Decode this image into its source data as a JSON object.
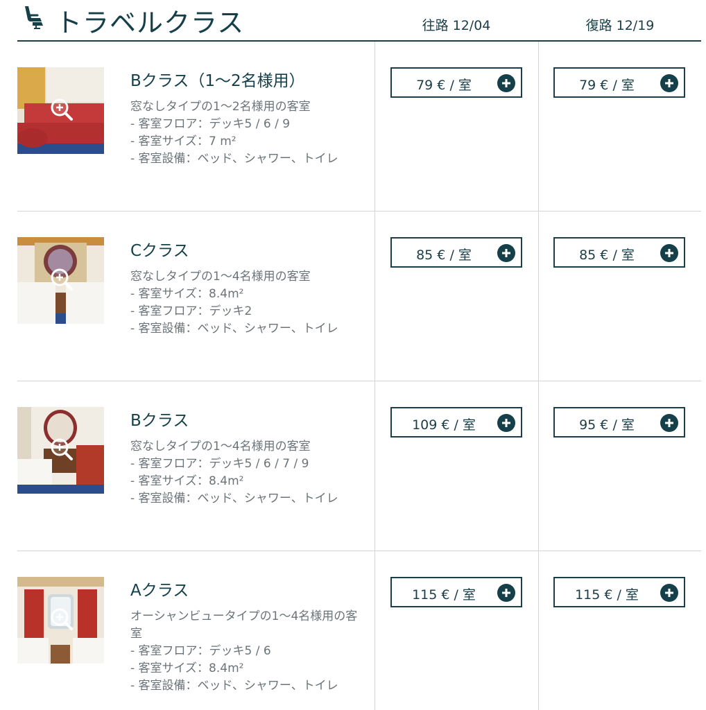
{
  "header": {
    "title": "トラベルクラス",
    "icon": "seat-icon",
    "outbound_label": "往路 12/04",
    "return_label": "復路 12/19"
  },
  "rooms": [
    {
      "name": "Bクラス（1〜2名様用）",
      "desc": [
        "窓なしタイプの1〜2名様用の客室",
        "- 客室フロア：デッキ5 / 6 / 9",
        "- 客室サイズ：7 m²",
        "- 客室設備：ベッド、シャワー、トイレ"
      ],
      "outbound_price": "79 € / 室",
      "return_price": "79 € / 室"
    },
    {
      "name": "Cクラス",
      "desc": [
        "窓なしタイプの1〜4名様用の客室",
        "- 客室サイズ：8.4m²",
        "- 客室フロア：デッキ2",
        "- 客室設備：ベッド、シャワー、トイレ"
      ],
      "outbound_price": "85 € / 室",
      "return_price": "85 € / 室"
    },
    {
      "name": "Bクラス",
      "desc": [
        "窓なしタイプの1〜4名様用の客室",
        "- 客室フロア：デッキ5 / 6 / 7 / 9",
        "- 客室サイズ：8.4m²",
        "- 客室設備：ベッド、シャワー、トイレ"
      ],
      "outbound_price": "109 € / 室",
      "return_price": "95 € / 室"
    },
    {
      "name": "Aクラス",
      "desc": [
        "オーシャンビュータイプの1〜4名様用の客室",
        "- 客室フロア：デッキ5 / 6",
        "- 客室サイズ：8.4m²",
        "- 客室設備：ベッド、シャワー、トイレ"
      ],
      "outbound_price": "115 € / 室",
      "return_price": "115 € / 室"
    }
  ],
  "icons": {
    "zoom": "zoom-in-icon",
    "add": "plus-circle-icon"
  },
  "colors": {
    "primary": "#1a3d47",
    "text_muted": "#6b7378",
    "divider": "#d4d4d4"
  }
}
